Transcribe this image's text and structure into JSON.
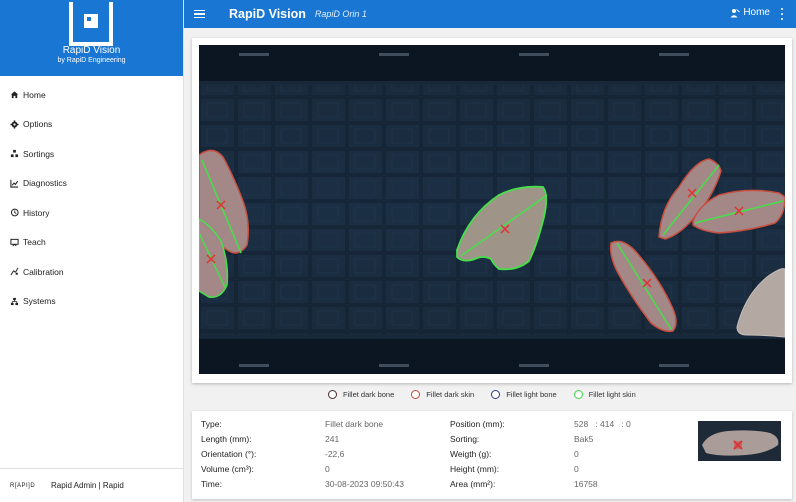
{
  "brand": {
    "title": "RapiD Vision",
    "subtitle": "by RapiD Engineering"
  },
  "topbar": {
    "title": "RapiD Vision",
    "subtitle": "RapiD Orin 1",
    "home_label": "Home"
  },
  "nav": [
    {
      "label": "Home",
      "icon": "home-icon"
    },
    {
      "label": "Options",
      "icon": "gear-icon"
    },
    {
      "label": "Sortings",
      "icon": "sortings-icon"
    },
    {
      "label": "Diagnostics",
      "icon": "chart-icon"
    },
    {
      "label": "History",
      "icon": "history-icon"
    },
    {
      "label": "Teach",
      "icon": "teach-icon"
    },
    {
      "label": "Calibration",
      "icon": "calibration-icon"
    },
    {
      "label": "Systems",
      "icon": "systems-icon"
    }
  ],
  "footer": {
    "logo": "R[API]D",
    "user": "Rapid Admin | Rapid"
  },
  "legend": [
    {
      "label": "Fillet dark bone",
      "color": "#4a2a2a"
    },
    {
      "label": "Fillet dark skin",
      "color": "#c24a3a"
    },
    {
      "label": "Fillet light bone",
      "color": "#2b3a86"
    },
    {
      "label": "Fillet light skin",
      "color": "#3ed44a"
    }
  ],
  "info": {
    "left": [
      {
        "label": "Type:",
        "value": "Fillet dark bone"
      },
      {
        "label": "Length (mm):",
        "value": "241"
      },
      {
        "label": "Orientation (°):",
        "value": "-22,6"
      },
      {
        "label": "Volume (cm³):",
        "value": "0"
      },
      {
        "label": "Time:",
        "value": "30-08-2023 09:50:43"
      }
    ],
    "right": [
      {
        "label": "Position (mm):",
        "value": "528   : 414   : 0"
      },
      {
        "label": "Sorting:",
        "value": "Bak5"
      },
      {
        "label": "Weigth (g):",
        "value": "0"
      },
      {
        "label": "Height (mm):",
        "value": "0"
      },
      {
        "label": "Area (mm²):",
        "value": "16758"
      }
    ]
  },
  "colors": {
    "primary": "#1976d2",
    "detection_green": "#3ed44a",
    "detection_red": "#e03030"
  }
}
